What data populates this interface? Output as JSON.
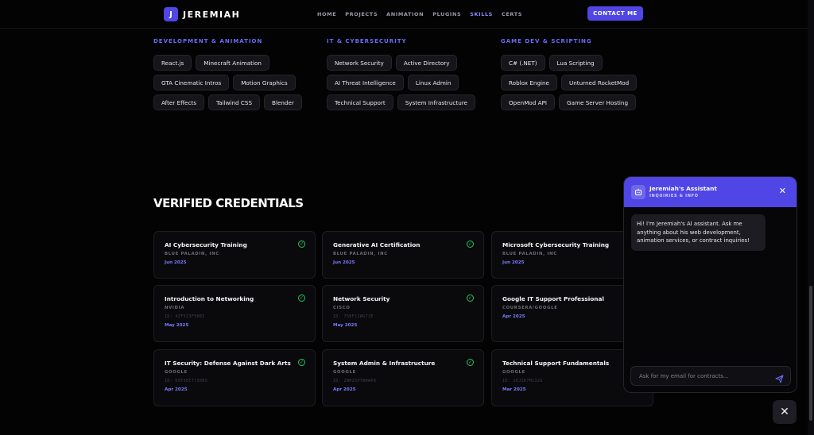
{
  "nav": {
    "brand_mark": "J",
    "brand_name": "JEREMIAH",
    "links": [
      "HOME",
      "PROJECTS",
      "ANIMATION",
      "PLUGINS",
      "SKILLS",
      "CERTS"
    ],
    "active_link": "SKILLS",
    "cta": "CONTACT ME"
  },
  "skills": [
    {
      "heading": "DEVELOPMENT & ANIMATION",
      "chips": [
        "React.js",
        "Minecraft Animation",
        "GTA Cinematic Intros",
        "Motion Graphics",
        "After Effects",
        "Tailwind CSS",
        "Blender"
      ]
    },
    {
      "heading": "IT & CYBERSECURITY",
      "chips": [
        "Network Security",
        "Active Directory",
        "AI Threat Intelligence",
        "Linux Admin",
        "Technical Support",
        "System Infrastructure"
      ]
    },
    {
      "heading": "GAME DEV & SCRIPTING",
      "chips": [
        "C# (.NET)",
        "Lua Scripting",
        "Roblox Engine",
        "Unturned RocketMod",
        "OpenMod API",
        "Game Server Hosting"
      ]
    }
  ],
  "credentials": {
    "title": "VERIFIED CREDENTIALS",
    "cards": [
      {
        "title": "AI Cybersecurity Training",
        "issuer": "BLUE PALADIN, INC",
        "id": "",
        "date": "Jun 2025",
        "verified": true
      },
      {
        "title": "Generative AI Certification",
        "issuer": "BLUE PALADIN, INC",
        "id": "",
        "date": "Jun 2025",
        "verified": true
      },
      {
        "title": "Microsoft Cybersecurity Training",
        "issuer": "BLUE PALADIN, INC",
        "id": "",
        "date": "Jun 2025",
        "verified": false
      },
      {
        "title": "Introduction to Networking",
        "issuer": "NVIDIA",
        "id": "ID: 4ZF5I3F5H8I",
        "date": "May 2025",
        "verified": true
      },
      {
        "title": "Network Security",
        "issuer": "CISCO",
        "id": "ID: 75KF1IWG7JE",
        "date": "May 2025",
        "verified": true
      },
      {
        "title": "Google IT Support Professional",
        "issuer": "COURSERA/GOOGLE",
        "id": "",
        "date": "Apr 2025",
        "verified": false
      },
      {
        "title": "IT Security: Defense Against Dark Arts",
        "issuer": "GOOGLE",
        "id": "ID: K9T5ECT7IRNS",
        "date": "Apr 2025",
        "verified": true
      },
      {
        "title": "System Admin & Infrastructure",
        "issuer": "GOOGLE",
        "id": "ID: ZNH2SV7WHAP8",
        "date": "Apr 2025",
        "verified": true
      },
      {
        "title": "Technical Support Fundamentals",
        "issuer": "GOOGLE",
        "id": "ID: 1EJ1K7M1I2G",
        "date": "Mar 2025",
        "verified": false
      }
    ]
  },
  "chat": {
    "title": "Jeremiah's Assistant",
    "subtitle": "INQUIRIES & INFO",
    "message": "Hi! I'm Jeremiah's AI assistant. Ask me anything about his web development, animation services, or contract inquiries!",
    "placeholder": "Ask for my email for contracts...",
    "close_glyph": "✕"
  },
  "fab_glyph": "✕",
  "colors": {
    "accent": "#4f46e5",
    "accent_text": "#7b7bff",
    "verified": "#22c55e",
    "background": "#030303"
  }
}
